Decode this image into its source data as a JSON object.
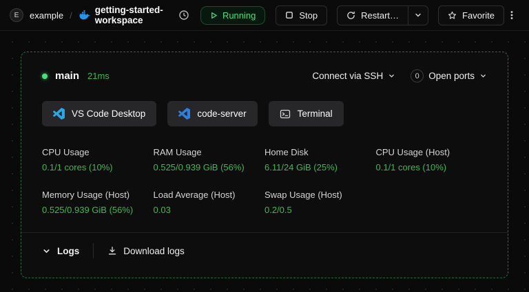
{
  "colors": {
    "accent_green": "#3fb950",
    "status_green": "#4ade80",
    "vscode_blue": "#29a8e9"
  },
  "topbar": {
    "org_initial": "E",
    "org_name": "example",
    "separator": "/",
    "workspace_name": "getting-started-workspace",
    "status": "Running",
    "stop": "Stop",
    "restart": "Restart…",
    "favorite": "Favorite"
  },
  "card": {
    "agent_name": "main",
    "latency": "21ms",
    "connect_ssh": "Connect via SSH",
    "ports_count": "0",
    "open_ports": "Open ports",
    "apps": [
      {
        "label": "VS Code Desktop"
      },
      {
        "label": "code-server"
      },
      {
        "label": "Terminal"
      }
    ],
    "stats": [
      {
        "label": "CPU Usage",
        "value": "0.1/1 cores (10%)"
      },
      {
        "label": "RAM Usage",
        "value": "0.525/0.939 GiB (56%)"
      },
      {
        "label": "Home Disk",
        "value": "6.11/24 GiB (25%)"
      },
      {
        "label": "CPU Usage (Host)",
        "value": "0.1/1 cores (10%)"
      },
      {
        "label": "Memory Usage (Host)",
        "value": "0.525/0.939 GiB (56%)"
      },
      {
        "label": "Load Average (Host)",
        "value": "0.03"
      },
      {
        "label": "Swap Usage (Host)",
        "value": "0.2/0.5"
      }
    ],
    "logs": "Logs",
    "download_logs": "Download logs"
  }
}
